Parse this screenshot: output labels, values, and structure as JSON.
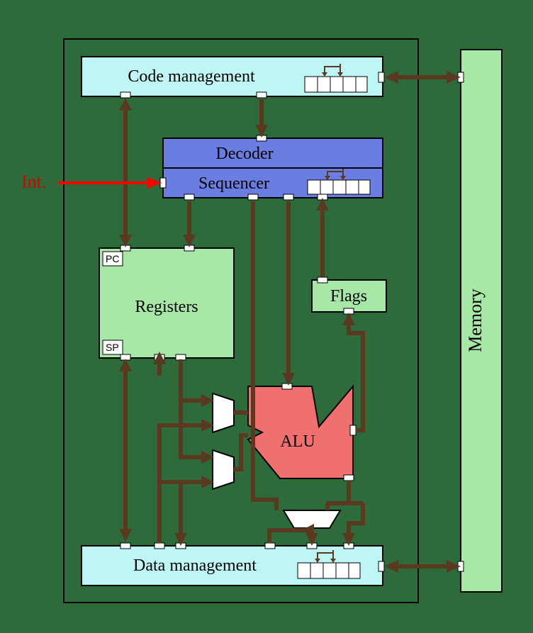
{
  "blocks": {
    "code_management": {
      "label": "Code management"
    },
    "decoder": {
      "label": "Decoder"
    },
    "sequencer": {
      "label": "Sequencer"
    },
    "registers": {
      "label": "Registers",
      "pc": "PC",
      "sp": "SP"
    },
    "flags": {
      "label": "Flags"
    },
    "alu": {
      "label": "ALU"
    },
    "data_management": {
      "label": "Data management"
    },
    "memory": {
      "label": "Memory"
    }
  },
  "signals": {
    "interrupt": "Int."
  }
}
